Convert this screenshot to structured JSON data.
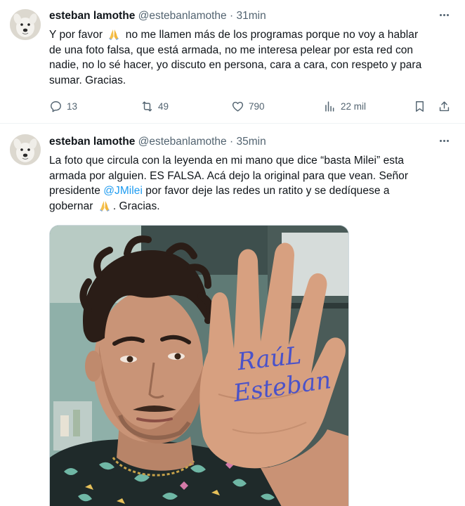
{
  "tweets": [
    {
      "author_name": "esteban lamothe",
      "handle": "@estebanlamothe",
      "separator": "·",
      "time": "31min",
      "avatar_icon": "dog-avatar",
      "text_lines": [
        [
          "Y por favor ",
          "🙏",
          " no me llamen más de los programas porque no voy a hablar"
        ],
        [
          "de  una foto falsa,  que está armada, no me interesa pelear por esta red con"
        ],
        [
          "nadie, no lo sé hacer, yo discuto en persona, cara a cara, con respeto y para"
        ],
        [
          "sumar. Gracias."
        ]
      ],
      "stats": {
        "replies": "13",
        "reposts": "49",
        "likes": "790",
        "views": "22 mil"
      }
    },
    {
      "author_name": "esteban lamothe",
      "handle": "@estebanlamothe",
      "separator": "·",
      "time": "35min",
      "avatar_icon": "dog-avatar",
      "text": {
        "l1": "La foto  que circula con la leyenda en mi mano que dice “basta Milei” esta",
        "l2": "armada por alguien. ES FALSA. Acá dejo la original para que vean. Señor",
        "l3_pre": "presidente ",
        "l3_mention": "@JMilei",
        "l3_post": "  por favor deje  las redes un ratito y se dedíquese  a",
        "l4_pre": "gobernar ",
        "l4_post": ". Gracias."
      },
      "photo": {
        "hand_text_line1": "RaúL",
        "hand_text_line2": "Esteban",
        "ink_color": "#4a52c9"
      }
    }
  ],
  "colors": {
    "text": "#0f1419",
    "secondary": "#536471",
    "mention": "#1d9bf0",
    "divider": "#eff3f4"
  }
}
